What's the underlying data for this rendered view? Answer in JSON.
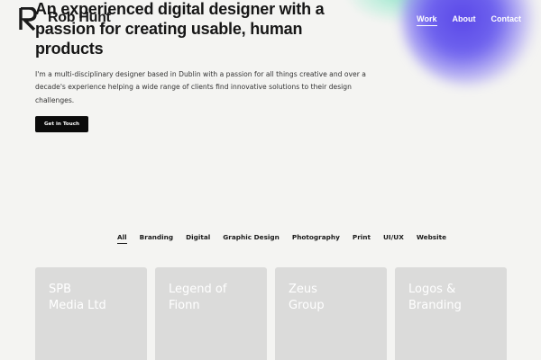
{
  "brand": {
    "name": "Rob Hunt"
  },
  "nav": {
    "items": [
      {
        "label": "Work",
        "active": true
      },
      {
        "label": "About",
        "active": false
      },
      {
        "label": "Contact",
        "active": false
      }
    ]
  },
  "hero": {
    "title": "An experienced digital designer with a passion for creating usable, human products",
    "description": "I'm a multi-disciplinary designer based in Dublin with a passion for all things creative and over a decade's experience helping a wide range of clients find innovative solutions to their design challenges.",
    "cta_label": "Get in Touch"
  },
  "filters": [
    {
      "label": "All",
      "active": true
    },
    {
      "label": "Branding"
    },
    {
      "label": "Digital"
    },
    {
      "label": "Graphic Design"
    },
    {
      "label": "Photography"
    },
    {
      "label": "Print"
    },
    {
      "label": "UI/UX"
    },
    {
      "label": "Website"
    }
  ],
  "projects": [
    {
      "title": "SPB\nMedia Ltd"
    },
    {
      "title": "Legend of\nFionn"
    },
    {
      "title": "Zeus\nGroup"
    },
    {
      "title": "Logos &\nBranding"
    }
  ],
  "colors": {
    "background": "#f4f4f2",
    "text": "#111111",
    "button": "#0b0b0b",
    "card": "#dbdbda",
    "blob_purple": "#5a48e8",
    "blob_mint": "#78e1be"
  }
}
